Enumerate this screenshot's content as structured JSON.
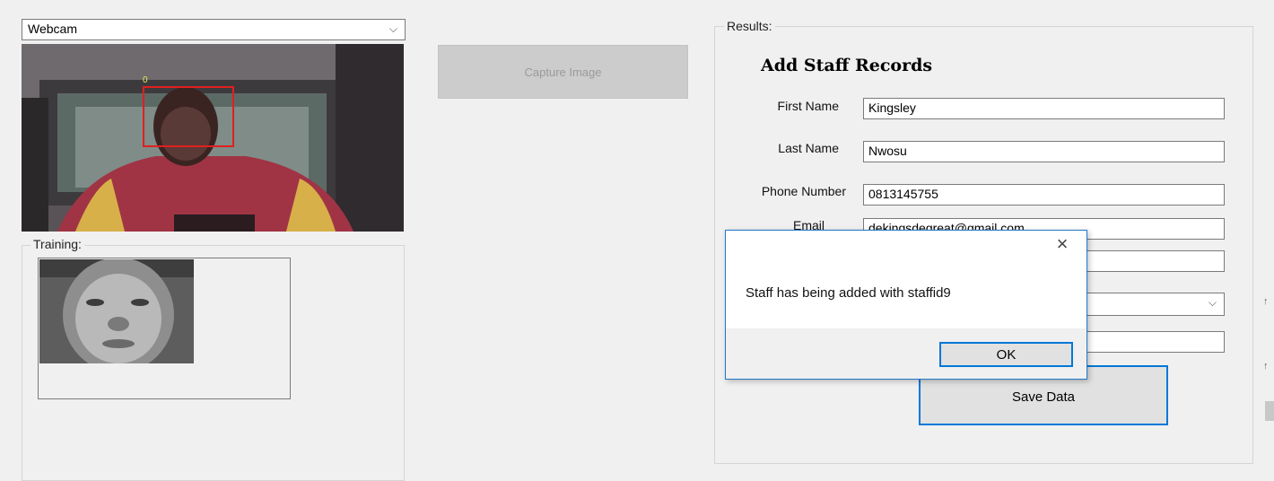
{
  "camera": {
    "source": "Webcam",
    "face_id_tag": "0"
  },
  "training": {
    "title": "Training:"
  },
  "capture": {
    "label": "Capture Image"
  },
  "results": {
    "title": "Results:",
    "form_title": "Add Staff Records",
    "fields": [
      {
        "label": "First Name",
        "value": "Kingsley"
      },
      {
        "label": "Last Name",
        "value": "Nwosu"
      },
      {
        "label": "Phone Number",
        "value": "0813145755"
      },
      {
        "label": "Email",
        "value": "dekingsdegreat@gmail.com"
      }
    ],
    "save_label": "Save Data"
  },
  "dialog": {
    "message": "Staff has being added with staffid9",
    "ok_label": "OK"
  },
  "colors": {
    "accent": "#0078d7",
    "face_box": "#e0201e",
    "face_tag": "#e8e85a"
  }
}
